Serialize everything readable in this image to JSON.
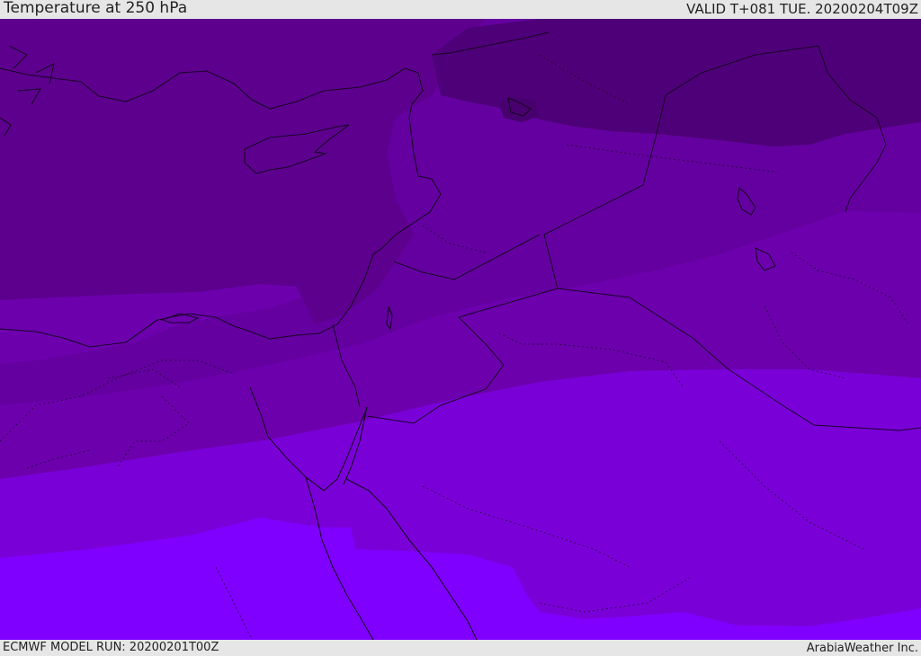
{
  "header": {
    "title": "Temperature at 250 hPa",
    "valid_time": "VALID T+081 TUE. 20200204T09Z"
  },
  "footer": {
    "model_run": "ECMWF MODEL RUN: 20200201T00Z",
    "credit": "ArabiaWeather Inc."
  },
  "map": {
    "colors": {
      "band_darkest": "#4e0078",
      "band_dark": "#5d008e",
      "band_mid": "#6400a0",
      "band_light": "#6c00ad",
      "band_lighter": "#7a00d8",
      "band_brightest": "#7f00ff",
      "outline": "#1a0028"
    }
  }
}
